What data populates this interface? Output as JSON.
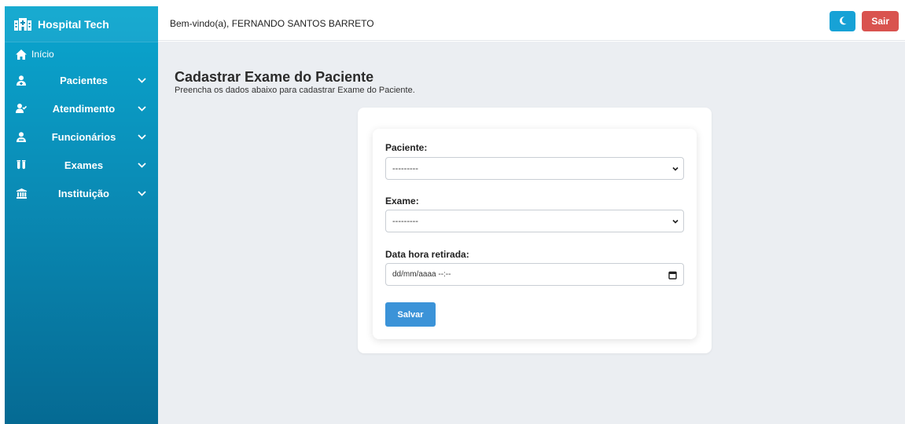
{
  "sidebar": {
    "brand": {
      "title": "Hospital Tech",
      "icon": "hospital-icon"
    },
    "items": [
      {
        "label": "Início",
        "icon": "home-icon"
      },
      {
        "label": "Pacientes",
        "icon": "patient-icon"
      },
      {
        "label": "Atendimento",
        "icon": "user-check-icon"
      },
      {
        "label": "Funcionários",
        "icon": "employee-icon"
      },
      {
        "label": "Exames",
        "icon": "vials-icon"
      },
      {
        "label": "Instituição",
        "icon": "building-columns-icon"
      }
    ]
  },
  "topbar": {
    "welcome": "Bem-vindo(a), FERNANDO SANTOS BARRETO",
    "theme_toggle_icon": "moon-icon",
    "logout_label": "Sair"
  },
  "page": {
    "title": "Cadastrar Exame do Paciente",
    "subtitle": "Preencha os dados abaixo para cadastrar Exame do Paciente."
  },
  "form": {
    "patient_label": "Paciente:",
    "patient_value": "---------",
    "exam_label": "Exame:",
    "exam_value": "---------",
    "datetime_label": "Data hora retirada:",
    "datetime_placeholder": "dd/mm/aaaa --:--",
    "save_label": "Salvar"
  },
  "colors": {
    "sidebar_top": "#0aa6cf",
    "sidebar_bottom": "#056a93",
    "theme_button": "#17a2d6",
    "logout_button": "#d9534f",
    "save_button": "#3b93d8",
    "main_background": "#ebeef2"
  }
}
